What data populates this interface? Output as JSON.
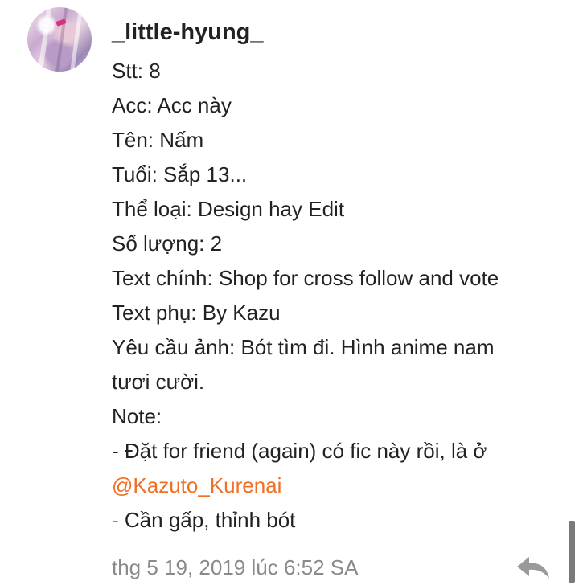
{
  "comment": {
    "username": "_little-hyung_",
    "avatar_icon": "user-avatar",
    "lines": {
      "stt": "Stt: 8",
      "acc": "Acc: Acc này",
      "ten": "Tên: Nấm",
      "tuoi": "Tuổi: Sắp 13...",
      "the_loai": "Thể loại: Design hay Edit",
      "so_luong": "Số lượng: 2",
      "text_chinh": "Text chính: Shop for cross follow and vote",
      "text_phu": "Text phụ: By Kazu",
      "yeu_cau_1": "Yêu cầu ảnh: Bót tìm đi. Hình anime nam",
      "yeu_cau_2": "tươi cười.",
      "note": "Note:",
      "note_item_1": "- Đặt for friend (again) có fic này rồi, là ở",
      "mention": "@Kazuto_Kurenai",
      "note_item_2_dash": "-",
      "note_item_2_text": " Cần gấp, thỉnh bót"
    },
    "timestamp": "thg 5 19, 2019 lúc 6:52 SA",
    "reply_icon": "reply-arrow-icon"
  },
  "colors": {
    "text": "#222222",
    "mention": "#f07026",
    "timestamp": "#8a8a8a",
    "reply_icon": "#9a9a9a"
  }
}
